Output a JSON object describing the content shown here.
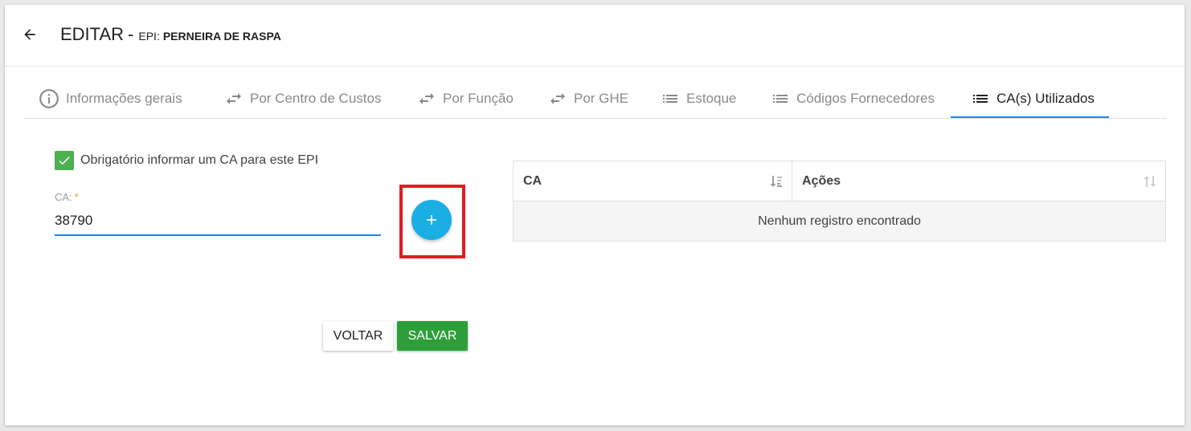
{
  "header": {
    "title": "EDITAR",
    "separator": "-",
    "entity_prefix": "EPI:",
    "entity_name": "PERNEIRA DE RASPA"
  },
  "tabs": [
    {
      "label": "Informações gerais",
      "icon": "info-icon"
    },
    {
      "label": "Por Centro de Custos",
      "icon": "swap-arrows-icon"
    },
    {
      "label": "Por Função",
      "icon": "swap-arrows-icon"
    },
    {
      "label": "Por GHE",
      "icon": "swap-arrows-icon"
    },
    {
      "label": "Estoque",
      "icon": "list-icon"
    },
    {
      "label": "Códigos Fornecedores",
      "icon": "list-icon"
    },
    {
      "label": "CA(s) Utilizados",
      "icon": "list-icon",
      "active": true
    }
  ],
  "form": {
    "checkbox_label": "Obrigatório informar um CA para este EPI",
    "checkbox_checked": true,
    "ca_label": "CA:",
    "ca_required_mark": "*",
    "ca_value": "38790",
    "add_button_icon": "plus-icon"
  },
  "buttons": {
    "back_label": "VOLTAR",
    "save_label": "SALVAR"
  },
  "table": {
    "columns": [
      "CA",
      "Ações"
    ],
    "empty_message": "Nenhum registro encontrado"
  },
  "colors": {
    "accent": "#1e88e5",
    "add_button": "#1aaee5",
    "save_button": "#2e9e3b",
    "checkbox": "#4caf50",
    "highlight": "#e31b23",
    "required": "#ff9800"
  }
}
